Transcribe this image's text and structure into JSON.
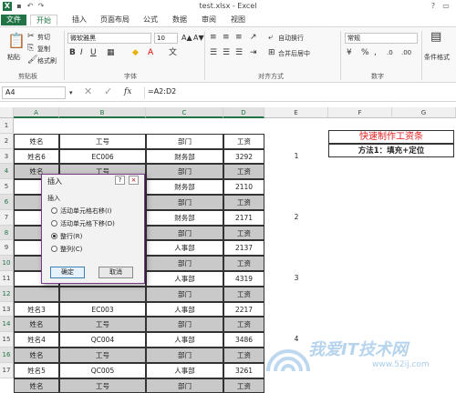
{
  "app": {
    "title": "test.xlsx - Excel"
  },
  "tabs": [
    "文件",
    "开始",
    "插入",
    "页面布局",
    "公式",
    "数据",
    "审阅",
    "视图"
  ],
  "ribbon": {
    "clipboard": {
      "paste": "粘贴",
      "cut": "剪切",
      "copy": "复制",
      "format_painter": "格式刷",
      "label": "剪贴板"
    },
    "font": {
      "name": "微软雅黑",
      "size": "10",
      "label": "字体"
    },
    "alignment": {
      "wrap": "自动换行",
      "merge": "合并后居中",
      "label": "对齐方式"
    },
    "number": {
      "format": "常规",
      "label": "数字"
    },
    "styles": {
      "conditional": "条件格式"
    }
  },
  "formula_bar": {
    "name_box": "A4",
    "fx": "fx",
    "formula": "=A2:D2"
  },
  "columns": [
    "A",
    "B",
    "C",
    "D",
    "E",
    "F",
    "G"
  ],
  "rows": [
    "1",
    "2",
    "3",
    "4",
    "5",
    "6",
    "7",
    "8",
    "9",
    "10",
    "11",
    "12",
    "13",
    "14",
    "15",
    "16",
    "17"
  ],
  "table": {
    "headers": [
      "姓名",
      "工号",
      "部门",
      "工资"
    ],
    "rows": [
      [
        "姓名6",
        "EC006",
        "财务部",
        "3292"
      ],
      [
        "姓名",
        "工号",
        "部门",
        "工资"
      ],
      [
        "",
        "",
        "财务部",
        "2110"
      ],
      [
        "",
        "",
        "部门",
        "工资"
      ],
      [
        "",
        "",
        "财务部",
        "2171"
      ],
      [
        "",
        "",
        "部门",
        "工资"
      ],
      [
        "",
        "",
        "人事部",
        "2137"
      ],
      [
        "",
        "",
        "部门",
        "工资"
      ],
      [
        "",
        "",
        "人事部",
        "4319"
      ],
      [
        "",
        "",
        "部门",
        "工资"
      ],
      [
        "姓名3",
        "EC003",
        "人事部",
        "2217"
      ],
      [
        "姓名",
        "工号",
        "部门",
        "工资"
      ],
      [
        "姓名4",
        "QC004",
        "人事部",
        "3486"
      ],
      [
        "姓名",
        "工号",
        "部门",
        "工资"
      ],
      [
        "姓名5",
        "QC005",
        "人事部",
        "3261"
      ],
      [
        "姓名",
        "工号",
        "部门",
        "工资"
      ]
    ]
  },
  "col_e": {
    "r3": "1",
    "r7": "2",
    "r11": "3",
    "r15": "4"
  },
  "side": {
    "title": "快速制作工资条",
    "method": "方法1：填充+定位"
  },
  "dialog": {
    "title": "插入",
    "help": "?",
    "close": "×",
    "group": "插入",
    "options": [
      "活动单元格右移(I)",
      "活动单元格下移(D)",
      "整行(R)",
      "整列(C)"
    ],
    "selected": 2,
    "ok": "确定",
    "cancel": "取消"
  },
  "watermark": {
    "text": "我爱IT技术网",
    "url": "www.52ij.com"
  },
  "colors": {
    "accent": "#217346",
    "side_title": "#e02020"
  }
}
